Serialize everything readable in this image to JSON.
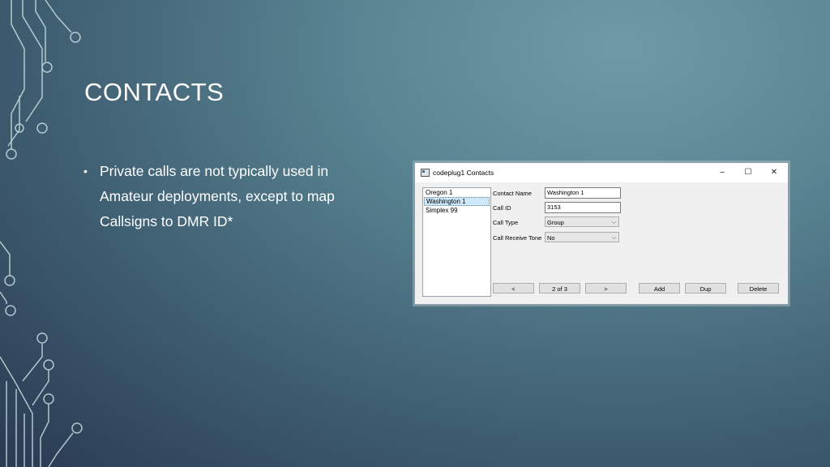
{
  "slide": {
    "title": "CONTACTS",
    "bullet": "Private calls are not typically used in Amateur deployments, except to map Callsigns to DMR ID*"
  },
  "window": {
    "title": "codeplug1 Contacts",
    "controls": {
      "minimize": "–",
      "maximize": "☐",
      "close": "✕"
    },
    "contacts": [
      "Oregon 1",
      "Washington 1",
      "Simplex 99"
    ],
    "selected_contact": "Washington 1",
    "form": {
      "contact_name_label": "Contact Name",
      "contact_name_value": "Washington 1",
      "call_id_label": "Call ID",
      "call_id_value": "3153",
      "call_type_label": "Call Type",
      "call_type_value": "Group",
      "call_receive_tone_label": "Call Receive Tone",
      "call_receive_tone_value": "No"
    },
    "buttons": {
      "prev": "<",
      "position": "2 of 3",
      "next": ">",
      "add": "Add",
      "dup": "Dup",
      "delete": "Delete"
    }
  },
  "colors": {
    "accent": "#3d84c6",
    "selection": "#cde8fb"
  }
}
